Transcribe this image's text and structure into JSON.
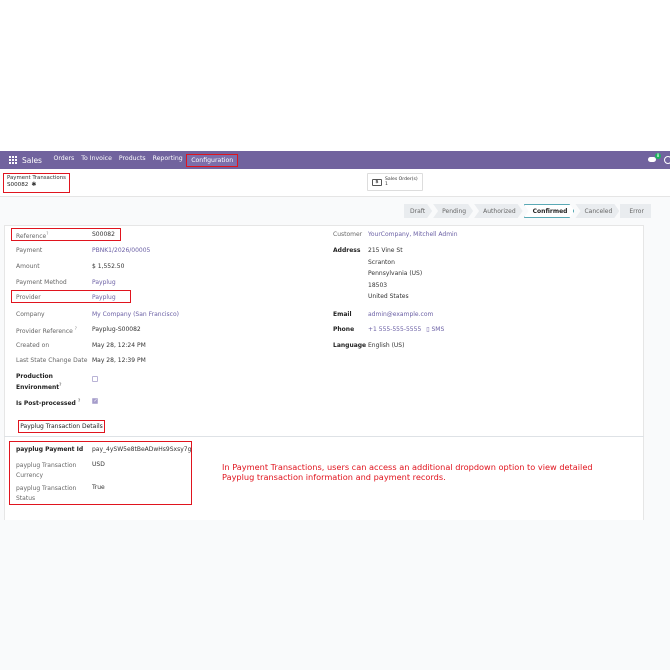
{
  "navbar": {
    "brand": "Sales",
    "menu": [
      "Orders",
      "To Invoice",
      "Products",
      "Reporting"
    ],
    "active_menu": "Configuration",
    "chat_badge": "8",
    "icons": [
      "apps-grid-icon",
      "chat-icon",
      "clock-icon"
    ]
  },
  "breadcrumb": {
    "parent": "Payment Transactions",
    "current": "S00082"
  },
  "smart_button": {
    "label": "Sales Order(s)",
    "count": "1",
    "icon": "dollar-bill-icon"
  },
  "statusbar": {
    "stages": [
      "Draft",
      "Pending",
      "Authorized",
      "Confirmed",
      "Canceled",
      "Error"
    ],
    "current": "Confirmed"
  },
  "left_fields": {
    "reference": {
      "label": "Reference",
      "value": "S00082"
    },
    "payment": {
      "label": "Payment",
      "value": "PBNK1/2026/00005"
    },
    "amount": {
      "label": "Amount",
      "value": "$ 1,552.50"
    },
    "payment_method": {
      "label": "Payment Method",
      "value": "Payplug"
    },
    "provider": {
      "label": "Provider",
      "value": "Payplug"
    },
    "company": {
      "label": "Company",
      "value": "My Company (San Francisco)"
    },
    "provider_reference": {
      "label": "Provider Reference",
      "value": "Payplug-S00082"
    },
    "created_on": {
      "label": "Created on",
      "value": "May 28, 12:24 PM"
    },
    "last_state_change": {
      "label": "Last State Change Date",
      "value": "May 28, 12:39 PM"
    },
    "production_env": {
      "label_line1": "Production",
      "label_line2": "Environment"
    },
    "post_processed": {
      "label": "Is Post-processed"
    }
  },
  "right_fields": {
    "customer": {
      "label": "Customer",
      "value": "YourCompany, Mitchell Admin"
    },
    "address": {
      "label": "Address",
      "lines": [
        "215 Vine St",
        "Scranton",
        "Pennsylvania (US)",
        "18503",
        "United States"
      ]
    },
    "email": {
      "label": "Email",
      "value": "admin@example.com"
    },
    "phone": {
      "label": "Phone",
      "value": "+1 555-555-5555",
      "sms": "SMS"
    },
    "language": {
      "label": "Language",
      "value": "English (US)"
    }
  },
  "tab": {
    "label": "Payplug Transaction Details"
  },
  "details": {
    "payment_id": {
      "label": "payplug Payment Id",
      "value": "pay_4ySW5e8tBeADwHs9Sxsy7g"
    },
    "currency": {
      "label_line1": "payplug Transaction",
      "label_line2": "Currency",
      "value": "USD"
    },
    "status": {
      "label_line1": "payplug Transaction",
      "label_line2": "Status",
      "value": "True"
    }
  },
  "annotation": "In Payment Transactions, users can access an additional dropdown option to view detailed Payplug transaction information and payment records.",
  "colors": {
    "navbar": "#71639e",
    "highlight": "#e0141e",
    "link": "#6b60a5",
    "current_stage_border": "#5aa9b5"
  }
}
